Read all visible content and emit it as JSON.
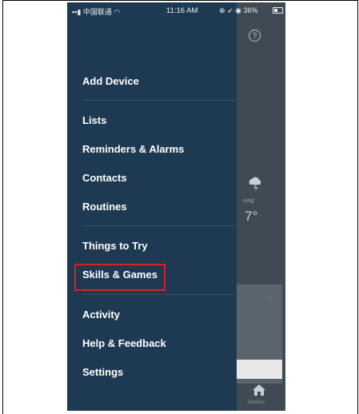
{
  "status_bar": {
    "carrier": "中国联通",
    "time": "11:16 AM",
    "battery": "36%"
  },
  "menu": {
    "add_device": "Add Device",
    "lists": "Lists",
    "reminders": "Reminders & Alarms",
    "contacts": "Contacts",
    "routines": "Routines",
    "things_to_try": "Things to Try",
    "skills_games": "Skills & Games",
    "activity": "Activity",
    "help_feedback": "Help & Feedback",
    "settings": "Settings"
  },
  "background": {
    "weather_text": "ning",
    "weather_temp": "7°",
    "devices_label": "Devices"
  },
  "colors": {
    "drawer": "#1e3a52",
    "highlight": "#d8202a"
  },
  "icons": {
    "help": "help-circle-icon",
    "weather": "cloud-storm-icon",
    "devices": "house-icon"
  }
}
